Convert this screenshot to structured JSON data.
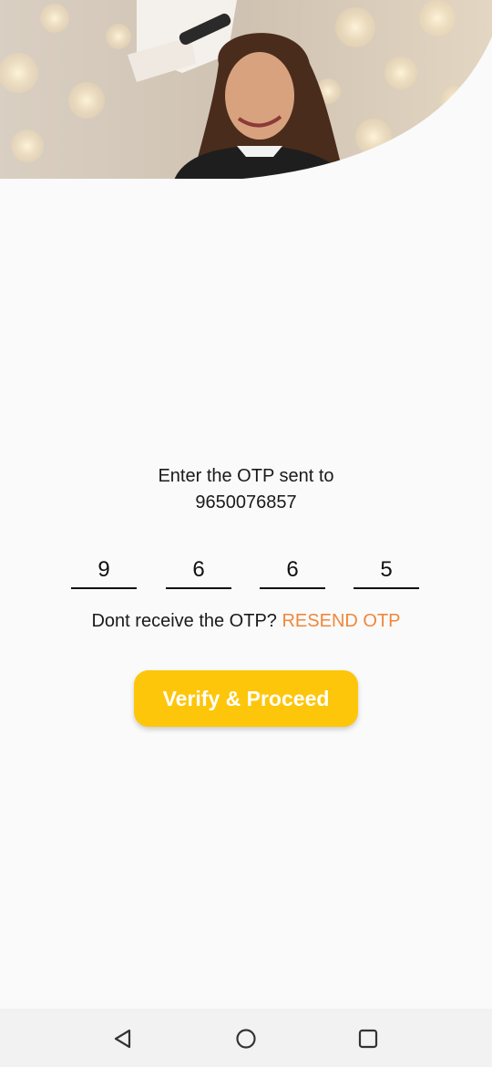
{
  "hero": {
    "image": "hairstylist-photo"
  },
  "otp": {
    "prompt_line1": "Enter the OTP sent to",
    "phone": "9650076857",
    "digits": [
      "9",
      "6",
      "6",
      "5"
    ]
  },
  "resend": {
    "text": "Dont receive the OTP?",
    "link": "RESEND OTP",
    "link_color": "#f0873a"
  },
  "verify_button": {
    "label": "Verify & Proceed",
    "color": "#fdc60a"
  },
  "navbar": {
    "icons": [
      "back-icon",
      "home-icon",
      "recents-icon"
    ]
  }
}
